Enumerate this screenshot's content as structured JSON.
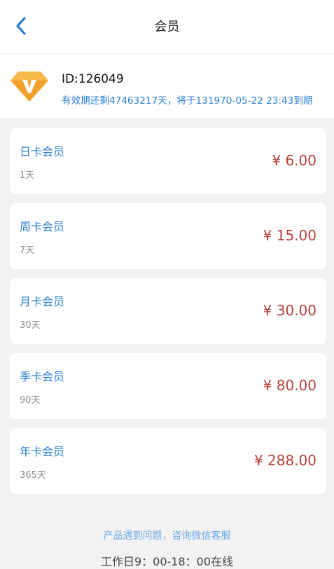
{
  "header": {
    "title": "会员",
    "back_icon": "chevron-left-icon"
  },
  "member": {
    "id_text": "ID:126049",
    "expiry_text": "有效期还剩47463217天，将于131970-05-22 23:43到期",
    "badge_icon": "vip-diamond-icon"
  },
  "plans": [
    {
      "name": "日卡会员",
      "duration": "1天",
      "price": "¥ 6.00"
    },
    {
      "name": "周卡会员",
      "duration": "7天",
      "price": "¥ 15.00"
    },
    {
      "name": "月卡会员",
      "duration": "30天",
      "price": "¥ 30.00"
    },
    {
      "name": "季卡会员",
      "duration": "90天",
      "price": "¥ 80.00"
    },
    {
      "name": "年卡会员",
      "duration": "365天",
      "price": "¥ 288.00"
    }
  ],
  "footer": {
    "help_text": "产品遇到问题，咨询微信客服",
    "hours_text": "工作日9：00-18：00在线"
  },
  "colors": {
    "accent_blue": "#2a7fd4",
    "price_red": "#b5413a",
    "badge_orange": "#f2a22c",
    "background": "#f2f2f2"
  }
}
